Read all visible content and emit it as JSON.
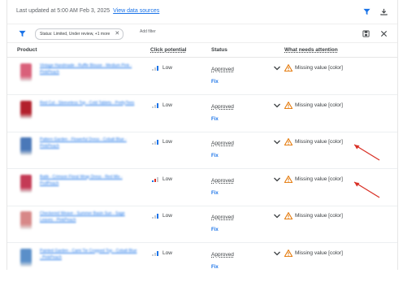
{
  "topbar": {
    "updated_text": "Last updated at 5:00 AM Feb 3, 2025",
    "data_sources_link": "View data sources"
  },
  "filterbar": {
    "chip_label": "Status: Limited, Under review, +1 more",
    "add_filter": "Add filter"
  },
  "columns": {
    "product": "Product",
    "click_potential": "Click potential",
    "status": "Status",
    "attention": "What needs attention"
  },
  "colors": {
    "accent": "#1a73e8",
    "warning": "#e37400",
    "arrow": "#d93025"
  },
  "rows": [
    {
      "product": "Vintage Handmade - Ruffle Blouse - Medium Pink - PinkPeach",
      "thumb_color": "#d9607a",
      "click_potential": "Low",
      "status": "Approved",
      "action": "Fix",
      "attention": "Missing value [color]",
      "bars": [
        "g",
        "g",
        "b"
      ]
    },
    {
      "product": "Red Cut - Sleeveless Top - Cold Tablets - PrettyTees",
      "thumb_color": "#b2202c",
      "click_potential": "Low",
      "status": "Approved",
      "action": "Fix",
      "attention": "Missing value [color]",
      "bars": [
        "g",
        "g",
        "b"
      ]
    },
    {
      "product": "Pattern Garden - Flowerful Dress - Cobalt Blue - PinkPeach",
      "thumb_color": "#4a78b8",
      "click_potential": "Low",
      "status": "Approved",
      "action": "Fix",
      "attention": "Missing value [color]",
      "bars": [
        "g",
        "g",
        "b"
      ]
    },
    {
      "product": "Batik - Crimson Floral Wrap Dress - Red Mix - ProfPeach",
      "thumb_color": "#c43a55",
      "click_potential": "Low",
      "status": "Approved",
      "action": "Fix",
      "attention": "Missing value [color]",
      "bars": [
        "b",
        "r",
        "g"
      ]
    },
    {
      "product": "Checkered Weave - Summer Basin Sun - Sage Leaves - PinkPeach",
      "thumb_color": "#d78888",
      "click_potential": "Low",
      "status": "Approved",
      "action": "Fix",
      "attention": "Missing value [color]",
      "bars": [
        "g",
        "g",
        "b"
      ]
    },
    {
      "product": "Painted Garden - Cami Tie Cropped Top - Cobalt Blue - PinkPeach",
      "thumb_color": "#5a8fc9",
      "click_potential": "Low",
      "status": "Approved",
      "action": "Fix",
      "attention": "Missing value [color]",
      "bars": [
        "g",
        "g",
        "b"
      ]
    }
  ]
}
